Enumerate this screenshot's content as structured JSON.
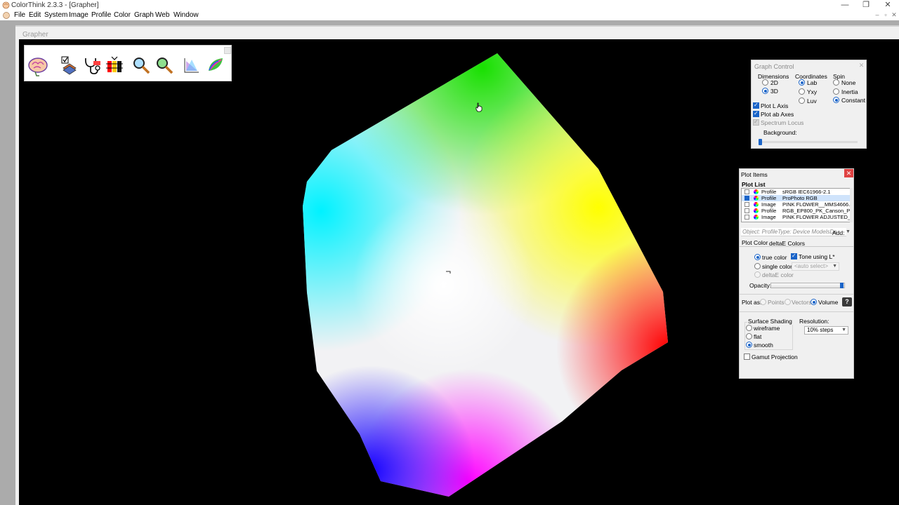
{
  "window": {
    "title": "ColorThink 2.3.3 - [Grapher]",
    "min_glyph": "—",
    "max_glyph": "❐",
    "close_glyph": "✕"
  },
  "menu": {
    "items": [
      {
        "label": "File"
      },
      {
        "label": "Edit"
      },
      {
        "label": "System"
      },
      {
        "label": "Image"
      },
      {
        "label": "Profile"
      },
      {
        "label": "Color"
      },
      {
        "label": "Graph"
      },
      {
        "label": "Web"
      },
      {
        "label": "Window"
      }
    ],
    "mdi_min": "–",
    "mdi_restore": "▫",
    "mdi_close": "✕"
  },
  "grapher": {
    "title": "Grapher",
    "toolbar_icons": [
      "brain-icon",
      "plot-icon",
      "stethoscope-icon",
      "color-compare-icon",
      "zoom-in-icon",
      "zoom-out-icon",
      "graph-2d-icon",
      "leaf-icon"
    ]
  },
  "graph_control": {
    "title": "Graph Control",
    "close_glyph": "✕",
    "dimensions": {
      "label": "Dimensions",
      "options": [
        "2D",
        "3D"
      ],
      "selected": "3D"
    },
    "coordinates": {
      "label": "Coordinates",
      "options": [
        "Lab",
        "Yxy",
        "Luv"
      ],
      "selected": "Lab"
    },
    "spin": {
      "label": "Spin",
      "options": [
        "None",
        "Inertia",
        "Constant"
      ],
      "selected": "Constant"
    },
    "plot_l_axis": {
      "label": "Plot L Axis",
      "checked": true
    },
    "plot_ab_axes": {
      "label": "Plot ab Axes",
      "checked": true
    },
    "spectrum_locus": {
      "label": "Spectrum Locus",
      "checked": true,
      "disabled": true
    },
    "background": {
      "label": "Background:",
      "level": 0
    }
  },
  "plot_items": {
    "title": "Plot Items",
    "close_glyph": "✕",
    "list_title": "Plot List",
    "rows": [
      {
        "type": "Profile",
        "name": "sRGB IEC61966-2.1",
        "checked": false,
        "selected": false
      },
      {
        "type": "Profile",
        "name": "ProPhoto RGB",
        "checked": true,
        "selected": true
      },
      {
        "type": "Image",
        "name": "PINK FLOWER__MMS4666.tif",
        "checked": false,
        "selected": false
      },
      {
        "type": "Profile",
        "name": "RGB_EP800_PK_Canson_Pl...",
        "checked": false,
        "selected": false
      },
      {
        "type": "Image",
        "name": "PINK FLOWER ADJUSTED_...",
        "checked": false,
        "selected": false
      }
    ],
    "object_info": "Object: ProfileType: Device ModelsDa",
    "add_label": "Add:",
    "tab_plot_color": "Plot Color",
    "tab_deltae_colors": "deltaE Colors",
    "true_color": "true color",
    "tone_using_l": "Tone using L*",
    "single_color": "single color:",
    "auto_select": "<auto select>",
    "deltae_color": "deltaE color",
    "opacity_label": "Opacity:",
    "opacity": 0.97,
    "plot_as_label": "Plot as:",
    "plot_as_options": [
      "Points",
      "Vectors",
      "Volume"
    ],
    "plot_as_selected": "Volume",
    "help_glyph": "?",
    "surface_shading_label": "Surface Shading",
    "shading_options": [
      "wireframe",
      "flat",
      "smooth"
    ],
    "shading_selected": "smooth",
    "resolution_label": "Resolution:",
    "resolution_value": "10% steps",
    "gamut_projection": "Gamut Projection"
  }
}
